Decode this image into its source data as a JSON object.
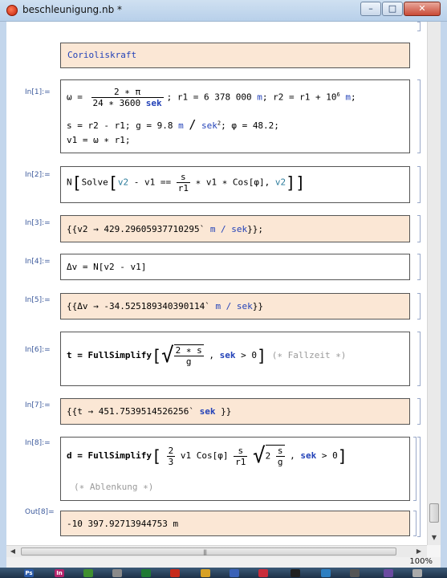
{
  "window": {
    "title": "beschleunigung.nb *",
    "min": "–",
    "max": "□",
    "close": "✕"
  },
  "cells": {
    "title_cell": "Corioliskraft",
    "in1": {
      "label": "In[1]:=",
      "omega_lhs": "ω =",
      "omega_num": "2 ∗ π",
      "omega_den_a": "24 ∗ 3600",
      "omega_den_unit": "sek",
      "line1_rest_a": "; r1 = 6 378 000",
      "unit_m": "m",
      "line1_rest_b": "; r2 = r1 + 10",
      "exp6": "6",
      "line1_rest_c": ";",
      "line2_a": "s = r2 - r1; g = 9.8",
      "line2_slash": "/",
      "line2_sek": "sek",
      "exp2": "2",
      "line2_b": "; φ = 48.2;",
      "line3": "v1 = ω ∗ r1;"
    },
    "in2": {
      "label": "In[2]:=",
      "a": "N",
      "b": "Solve",
      "v2": "v2",
      "c": " - v1 ==",
      "num": "s",
      "den": "r1",
      "d": "∗ v1 ∗ Cos[φ],",
      "e": "v2"
    },
    "out3": {
      "label": "In[3]:=",
      "text_a": "{{v2 → 429.29605937710295`",
      "unit": "m / sek",
      "text_b": "}};"
    },
    "in4": {
      "label": "In[4]:=",
      "text": "Δv = N[v2 - v1]"
    },
    "out5": {
      "label": "In[5]:=",
      "text_a": "{{Δv → -34.525189340390114`",
      "unit": "m / sek",
      "text_b": "}}"
    },
    "in6": {
      "label": "In[6]:=",
      "a": "t = FullSimplify",
      "num": "2 ∗ s",
      "den": "g",
      "b": ",",
      "sek": "sek",
      "c": "> 0",
      "comment": "(∗ Fallzeit ∗)"
    },
    "out7": {
      "label": "In[7]:=",
      "text_a": "{{t → 451.7539514526256`",
      "unit": "sek",
      "text_b": "}}"
    },
    "in8": {
      "label": "In[8]:=",
      "a": "d = FullSimplify",
      "f1n": "2",
      "f1d": "3",
      "b": "v1 Cos[φ]",
      "f2n": "s",
      "f2d": "r1",
      "c": "2",
      "f3n": "s",
      "f3d": "g",
      "d": ",",
      "sek": "sek",
      "e": "> 0",
      "comment": "(∗ Ablenkung ∗)"
    },
    "out8": {
      "label": "Out[8]=",
      "text": "-10 397.92713944753 m"
    }
  },
  "status": {
    "zoom": "100%"
  },
  "colors": {
    "cell_bg_out": "#fbe7d5",
    "keyword_blue": "#2342b8",
    "label_blue": "#3c5a9c"
  },
  "icons": [
    "app-icon",
    "minimize-icon",
    "maximize-icon",
    "close-icon"
  ]
}
